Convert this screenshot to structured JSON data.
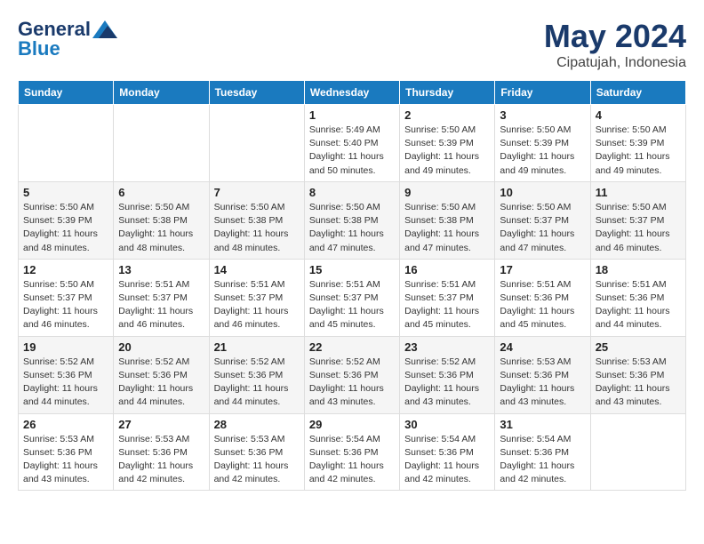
{
  "logo": {
    "general": "General",
    "blue": "Blue"
  },
  "title": "May 2024",
  "subtitle": "Cipatujah, Indonesia",
  "headers": [
    "Sunday",
    "Monday",
    "Tuesday",
    "Wednesday",
    "Thursday",
    "Friday",
    "Saturday"
  ],
  "weeks": [
    [
      {
        "day": "",
        "info": ""
      },
      {
        "day": "",
        "info": ""
      },
      {
        "day": "",
        "info": ""
      },
      {
        "day": "1",
        "info": "Sunrise: 5:49 AM\nSunset: 5:40 PM\nDaylight: 11 hours\nand 50 minutes."
      },
      {
        "day": "2",
        "info": "Sunrise: 5:50 AM\nSunset: 5:39 PM\nDaylight: 11 hours\nand 49 minutes."
      },
      {
        "day": "3",
        "info": "Sunrise: 5:50 AM\nSunset: 5:39 PM\nDaylight: 11 hours\nand 49 minutes."
      },
      {
        "day": "4",
        "info": "Sunrise: 5:50 AM\nSunset: 5:39 PM\nDaylight: 11 hours\nand 49 minutes."
      }
    ],
    [
      {
        "day": "5",
        "info": "Sunrise: 5:50 AM\nSunset: 5:39 PM\nDaylight: 11 hours\nand 48 minutes."
      },
      {
        "day": "6",
        "info": "Sunrise: 5:50 AM\nSunset: 5:38 PM\nDaylight: 11 hours\nand 48 minutes."
      },
      {
        "day": "7",
        "info": "Sunrise: 5:50 AM\nSunset: 5:38 PM\nDaylight: 11 hours\nand 48 minutes."
      },
      {
        "day": "8",
        "info": "Sunrise: 5:50 AM\nSunset: 5:38 PM\nDaylight: 11 hours\nand 47 minutes."
      },
      {
        "day": "9",
        "info": "Sunrise: 5:50 AM\nSunset: 5:38 PM\nDaylight: 11 hours\nand 47 minutes."
      },
      {
        "day": "10",
        "info": "Sunrise: 5:50 AM\nSunset: 5:37 PM\nDaylight: 11 hours\nand 47 minutes."
      },
      {
        "day": "11",
        "info": "Sunrise: 5:50 AM\nSunset: 5:37 PM\nDaylight: 11 hours\nand 46 minutes."
      }
    ],
    [
      {
        "day": "12",
        "info": "Sunrise: 5:50 AM\nSunset: 5:37 PM\nDaylight: 11 hours\nand 46 minutes."
      },
      {
        "day": "13",
        "info": "Sunrise: 5:51 AM\nSunset: 5:37 PM\nDaylight: 11 hours\nand 46 minutes."
      },
      {
        "day": "14",
        "info": "Sunrise: 5:51 AM\nSunset: 5:37 PM\nDaylight: 11 hours\nand 46 minutes."
      },
      {
        "day": "15",
        "info": "Sunrise: 5:51 AM\nSunset: 5:37 PM\nDaylight: 11 hours\nand 45 minutes."
      },
      {
        "day": "16",
        "info": "Sunrise: 5:51 AM\nSunset: 5:37 PM\nDaylight: 11 hours\nand 45 minutes."
      },
      {
        "day": "17",
        "info": "Sunrise: 5:51 AM\nSunset: 5:36 PM\nDaylight: 11 hours\nand 45 minutes."
      },
      {
        "day": "18",
        "info": "Sunrise: 5:51 AM\nSunset: 5:36 PM\nDaylight: 11 hours\nand 44 minutes."
      }
    ],
    [
      {
        "day": "19",
        "info": "Sunrise: 5:52 AM\nSunset: 5:36 PM\nDaylight: 11 hours\nand 44 minutes."
      },
      {
        "day": "20",
        "info": "Sunrise: 5:52 AM\nSunset: 5:36 PM\nDaylight: 11 hours\nand 44 minutes."
      },
      {
        "day": "21",
        "info": "Sunrise: 5:52 AM\nSunset: 5:36 PM\nDaylight: 11 hours\nand 44 minutes."
      },
      {
        "day": "22",
        "info": "Sunrise: 5:52 AM\nSunset: 5:36 PM\nDaylight: 11 hours\nand 43 minutes."
      },
      {
        "day": "23",
        "info": "Sunrise: 5:52 AM\nSunset: 5:36 PM\nDaylight: 11 hours\nand 43 minutes."
      },
      {
        "day": "24",
        "info": "Sunrise: 5:53 AM\nSunset: 5:36 PM\nDaylight: 11 hours\nand 43 minutes."
      },
      {
        "day": "25",
        "info": "Sunrise: 5:53 AM\nSunset: 5:36 PM\nDaylight: 11 hours\nand 43 minutes."
      }
    ],
    [
      {
        "day": "26",
        "info": "Sunrise: 5:53 AM\nSunset: 5:36 PM\nDaylight: 11 hours\nand 43 minutes."
      },
      {
        "day": "27",
        "info": "Sunrise: 5:53 AM\nSunset: 5:36 PM\nDaylight: 11 hours\nand 42 minutes."
      },
      {
        "day": "28",
        "info": "Sunrise: 5:53 AM\nSunset: 5:36 PM\nDaylight: 11 hours\nand 42 minutes."
      },
      {
        "day": "29",
        "info": "Sunrise: 5:54 AM\nSunset: 5:36 PM\nDaylight: 11 hours\nand 42 minutes."
      },
      {
        "day": "30",
        "info": "Sunrise: 5:54 AM\nSunset: 5:36 PM\nDaylight: 11 hours\nand 42 minutes."
      },
      {
        "day": "31",
        "info": "Sunrise: 5:54 AM\nSunset: 5:36 PM\nDaylight: 11 hours\nand 42 minutes."
      },
      {
        "day": "",
        "info": ""
      }
    ]
  ]
}
